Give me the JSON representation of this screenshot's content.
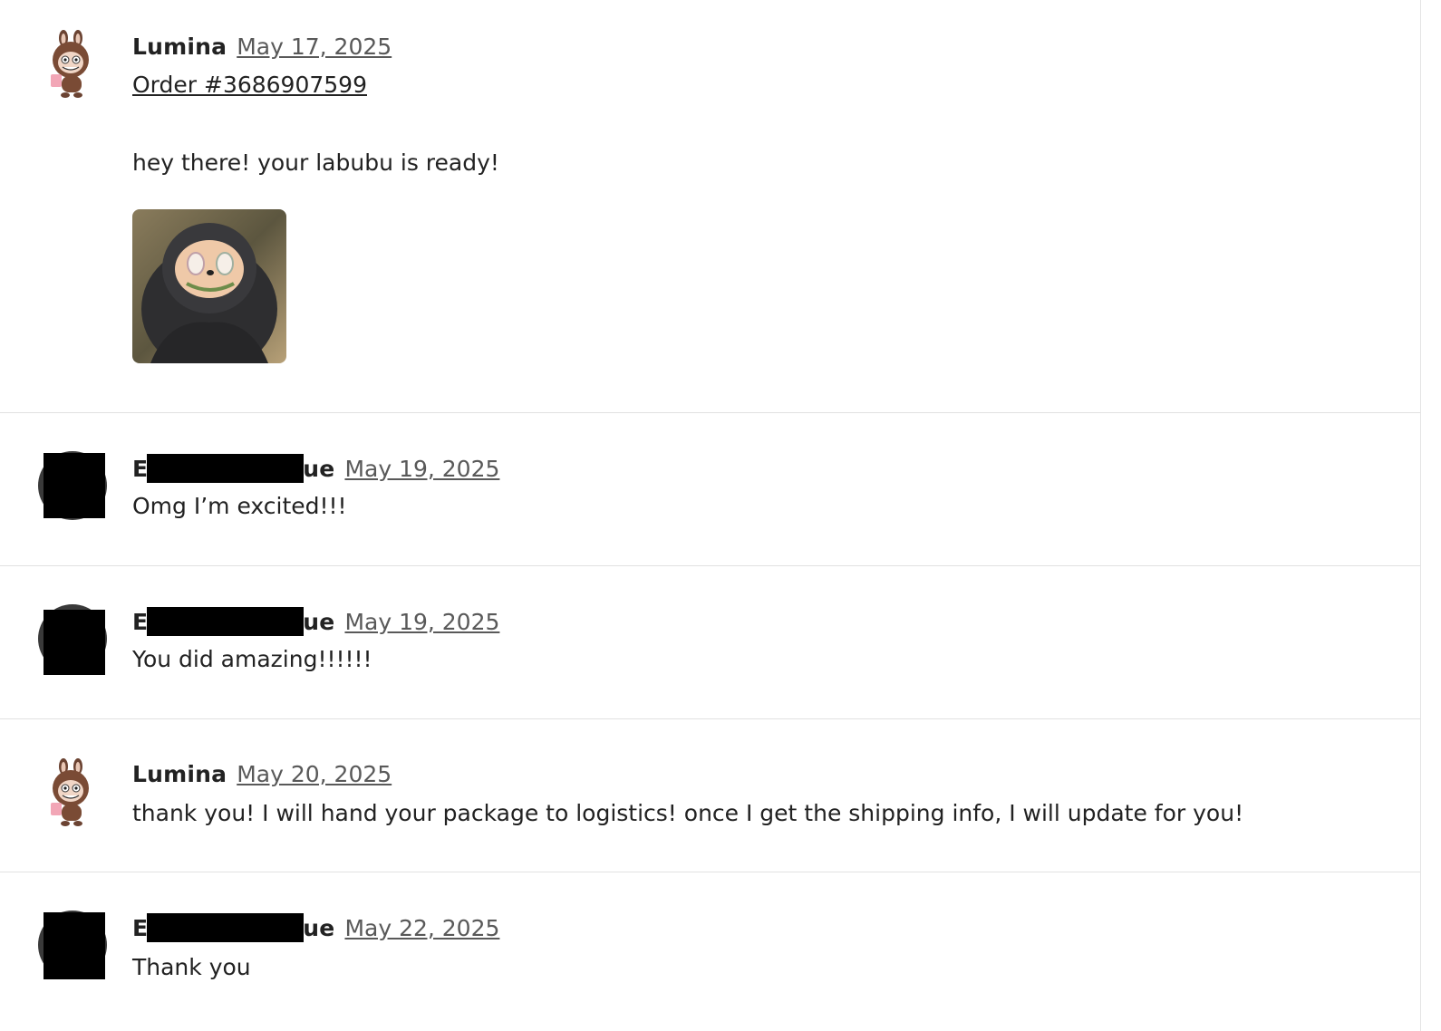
{
  "messages": [
    {
      "sender_visible_prefix": "Lumina",
      "date": "May 17, 2025",
      "order_link": "Order #3686907599",
      "text": "hey there! your labubu is ready!",
      "attachment": "labubu-photo"
    },
    {
      "sender_visible_prefix": "E",
      "sender_visible_suffix": "ue",
      "sender_redacted": true,
      "date": "May 19, 2025",
      "text": "Omg I’m excited!!!"
    },
    {
      "sender_visible_prefix": "E",
      "sender_visible_suffix": "ue",
      "sender_redacted": true,
      "date": "May 19, 2025",
      "text": "You did amazing!!!!!!"
    },
    {
      "sender_visible_prefix": "Lumina",
      "date": "May 20, 2025",
      "text": "thank you! I will hand your package to logistics! once I get the shipping info, I will update for you!"
    },
    {
      "sender_visible_prefix": "E",
      "sender_visible_suffix": "ue",
      "sender_redacted": true,
      "date": "May 22, 2025",
      "text": "Thank you"
    }
  ],
  "icons": {
    "shop_avatar": "labubu-mascot-icon",
    "buyer_avatar": "redacted-avatar-icon"
  },
  "colors": {
    "text": "#222222",
    "date": "#595959",
    "divider": "#e1e1e1",
    "redaction": "#000000"
  }
}
